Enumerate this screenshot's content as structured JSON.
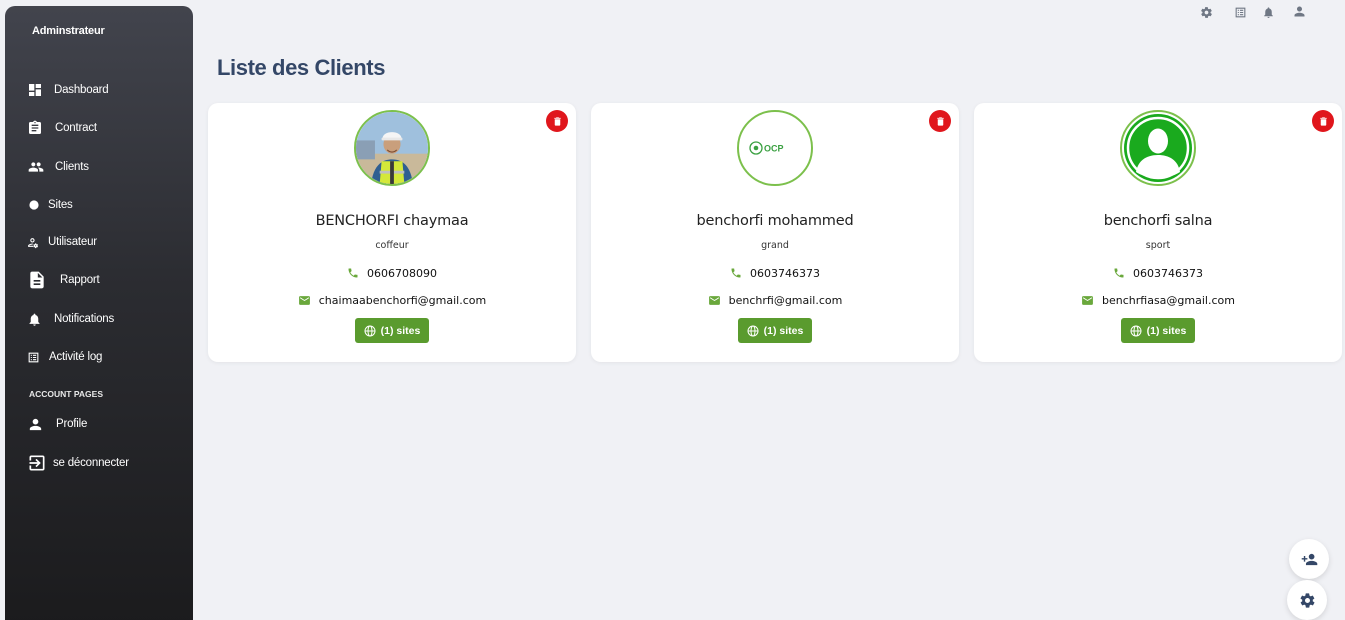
{
  "sidebar": {
    "brand": "Adminstrateur",
    "items": [
      {
        "label": "Dashboard",
        "icon": "dashboard-icon"
      },
      {
        "label": "Contract",
        "icon": "clipboard-icon"
      },
      {
        "label": "Clients",
        "icon": "people-icon"
      },
      {
        "label": "Sites",
        "icon": "globe-icon"
      },
      {
        "label": "Utilisateur",
        "icon": "user-settings-icon"
      },
      {
        "label": "Rapport",
        "icon": "document-icon"
      },
      {
        "label": "Notifications",
        "icon": "bell-icon"
      },
      {
        "label": "Activité log",
        "icon": "list-icon"
      }
    ],
    "section_label": "ACCOUNT PAGES",
    "account_items": [
      {
        "label": "Profile",
        "icon": "person-icon"
      },
      {
        "label": "se déconnecter",
        "icon": "logout-icon"
      }
    ]
  },
  "topbar": {
    "icons": [
      "settings-icon",
      "list-icon",
      "bell-icon",
      "user-icon"
    ]
  },
  "page": {
    "title": "Liste des Clients"
  },
  "clients": [
    {
      "name": "BENCHORFI chaymaa",
      "job": "coffeur",
      "phone": "0606708090",
      "email": "chaimaabenchorfi@gmail.com",
      "sites": "(1) sites",
      "avatar": "worker-photo"
    },
    {
      "name": "benchorfi mohammed",
      "job": "grand",
      "phone": "0603746373",
      "email": "benchrfi@gmail.com",
      "sites": "(1) sites",
      "avatar": "ocp-logo",
      "logo_text": "OCP"
    },
    {
      "name": "benchorfi salna",
      "job": "sport",
      "phone": "0603746373",
      "email": "benchrfiasa@gmail.com",
      "sites": "(1) sites",
      "avatar": "default-person"
    }
  ],
  "colors": {
    "accent_green": "#5a9b2e",
    "delete_red": "#e0161c",
    "title_blue": "#344767"
  },
  "fabs": [
    "add-user-icon",
    "gear-icon"
  ]
}
